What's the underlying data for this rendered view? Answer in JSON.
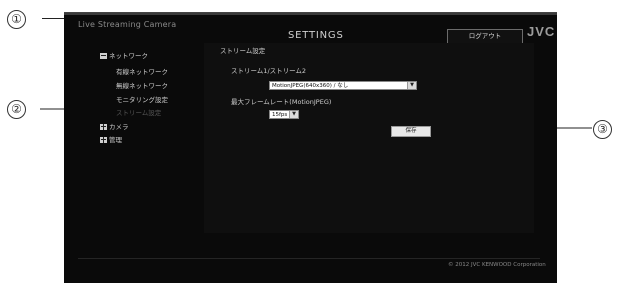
{
  "window": {
    "brand": "Live Streaming Camera",
    "title": "SETTINGS",
    "logout_label": "ログアウト",
    "logo": "JVC"
  },
  "sidebar": {
    "items": [
      {
        "label": "ネットワーク",
        "icon": "minus-box-icon"
      },
      {
        "label": "有線ネットワーク"
      },
      {
        "label": "無線ネットワーク"
      },
      {
        "label": "モニタリング設定"
      },
      {
        "label": "ストリーム設定"
      },
      {
        "label": "カメラ",
        "icon": "plus-box-icon"
      },
      {
        "label": "管理",
        "icon": "plus-box-icon"
      }
    ]
  },
  "content": {
    "heading": "ストリーム設定",
    "stream_label": "ストリーム1/ストリーム2",
    "stream_value": "MotionJPEG(640x360) / なし",
    "framerate_label": "最大フレームレート(MotionJPEG)",
    "framerate_value": "15fps",
    "save_label": "保存"
  },
  "footer": {
    "copyright": "© 2012 JVC KENWOOD Corporation"
  },
  "callouts": [
    "①",
    "②",
    "③"
  ]
}
